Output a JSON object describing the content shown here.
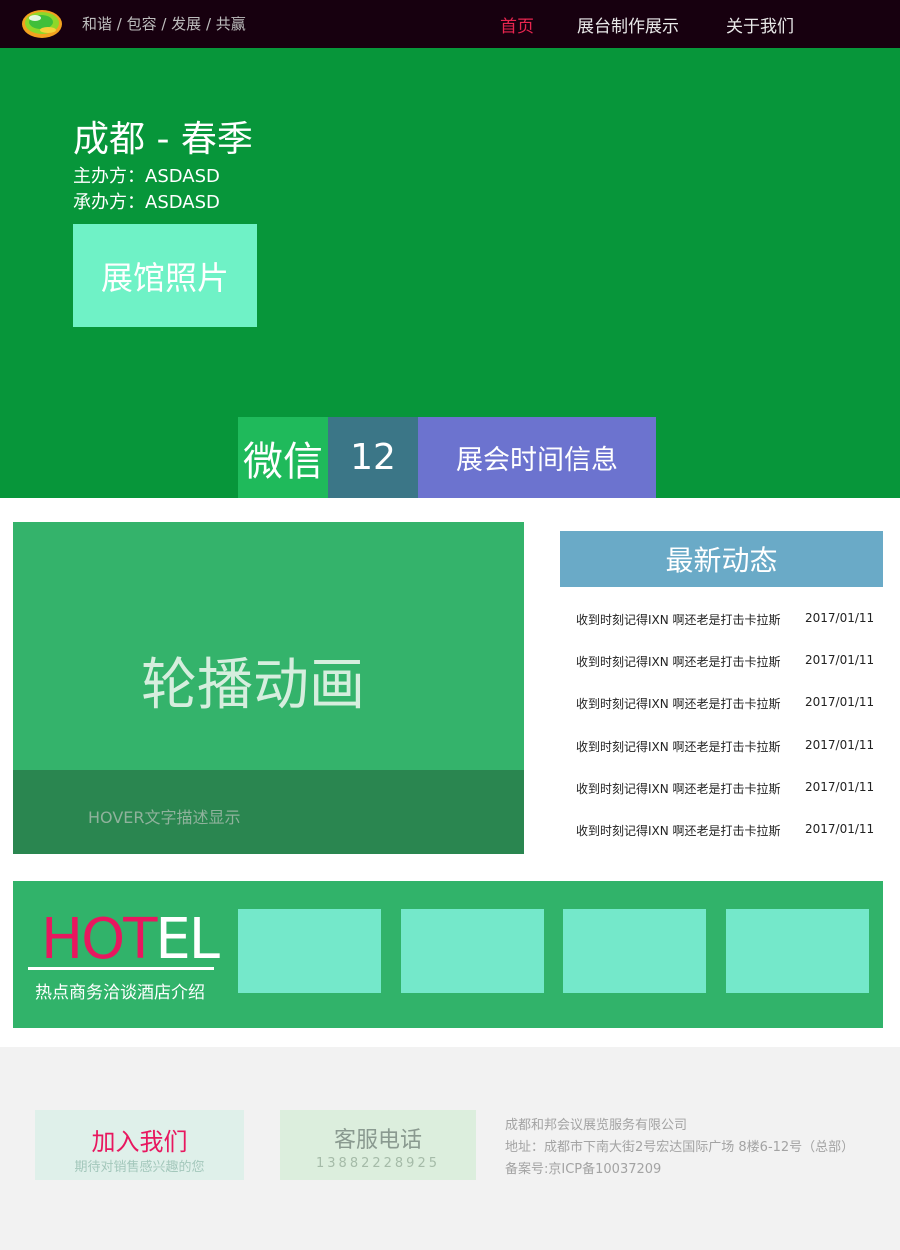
{
  "nav": {
    "slogan": "和谐 / 包容 / 发展 / 共赢",
    "items": [
      {
        "label": "首页",
        "active": true
      },
      {
        "label": "展台制作展示",
        "active": false
      },
      {
        "label": "关于我们",
        "active": false
      }
    ]
  },
  "hero": {
    "title": "成都 - 春季",
    "host": "主办方：ASDASD",
    "organizer": "承办方：ASDASD",
    "photo_button": "展馆照片",
    "tiles": {
      "wechat": "微信",
      "count": "12",
      "info": "展会时间信息"
    }
  },
  "carousel": {
    "title": "轮播动画",
    "caption": "HOVER文字描述显示"
  },
  "news": {
    "heading": "最新动态",
    "items": [
      {
        "text": "收到时刻记得IXN 啊还老是打击卡拉斯",
        "date": "2017/01/11"
      },
      {
        "text": "收到时刻记得IXN 啊还老是打击卡拉斯",
        "date": "2017/01/11"
      },
      {
        "text": "收到时刻记得IXN 啊还老是打击卡拉斯",
        "date": "2017/01/11"
      },
      {
        "text": "收到时刻记得IXN 啊还老是打击卡拉斯",
        "date": "2017/01/11"
      },
      {
        "text": "收到时刻记得IXN 啊还老是打击卡拉斯",
        "date": "2017/01/11"
      },
      {
        "text": "收到时刻记得IXN 啊还老是打击卡拉斯",
        "date": "2017/01/11"
      }
    ]
  },
  "hotel": {
    "logo_hot": "HOT",
    "logo_el": "EL",
    "subtitle": "热点商务洽谈酒店介绍"
  },
  "footer": {
    "join_title": "加入我们",
    "join_subtitle": "期待对销售感兴趣的您",
    "service_title": "客服电话",
    "service_phone": "13882228925",
    "company": "成都和邦会议展览服务有限公司",
    "address": "地址：成都市下南大街2号宏达国际广场 8楼6-12号（总部）",
    "icp": "备案号:京ICP备10037209"
  },
  "colors": {
    "nav_bg": "#17000f",
    "hero_bg": "#07963a",
    "accent_pink": "#e8175f",
    "wechat_tile": "#1fba5b",
    "count_tile": "#3b7687",
    "info_tile": "#6c73cf",
    "news_head": "#6aaac7",
    "hotel_bg": "#31b36a"
  }
}
